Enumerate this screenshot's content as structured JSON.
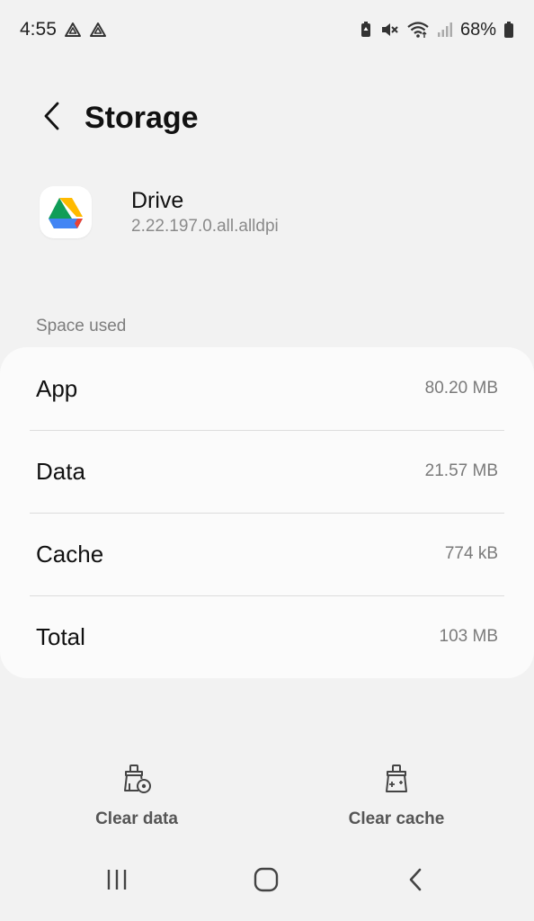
{
  "status_bar": {
    "time": "4:55",
    "battery": "68%",
    "icons": [
      "drive-notification-icon",
      "drive-notification-icon",
      "battery-saver-icon",
      "mute-icon",
      "wifi-icon",
      "signal-icon",
      "battery-icon"
    ]
  },
  "header": {
    "title": "Storage",
    "back_icon": "chevron-left-icon"
  },
  "app": {
    "name": "Drive",
    "version": "2.22.197.0.all.alldpi",
    "icon": "google-drive-icon"
  },
  "section_label": "Space used",
  "storage_rows": [
    {
      "label": "App",
      "value": "80.20 MB"
    },
    {
      "label": "Data",
      "value": "21.57 MB"
    },
    {
      "label": "Cache",
      "value": "774 kB"
    },
    {
      "label": "Total",
      "value": "103 MB"
    }
  ],
  "actions": {
    "clear_data": {
      "label": "Clear data",
      "icon": "clear-data-icon"
    },
    "clear_cache": {
      "label": "Clear cache",
      "icon": "clear-cache-icon"
    }
  },
  "nav_bar": {
    "icons": [
      "recents-icon",
      "home-icon",
      "back-icon"
    ]
  },
  "colors": {
    "background": "#f2f2f2",
    "card": "#fbfbfb",
    "secondary_text": "#7a7a7a",
    "action_text": "#555555"
  }
}
